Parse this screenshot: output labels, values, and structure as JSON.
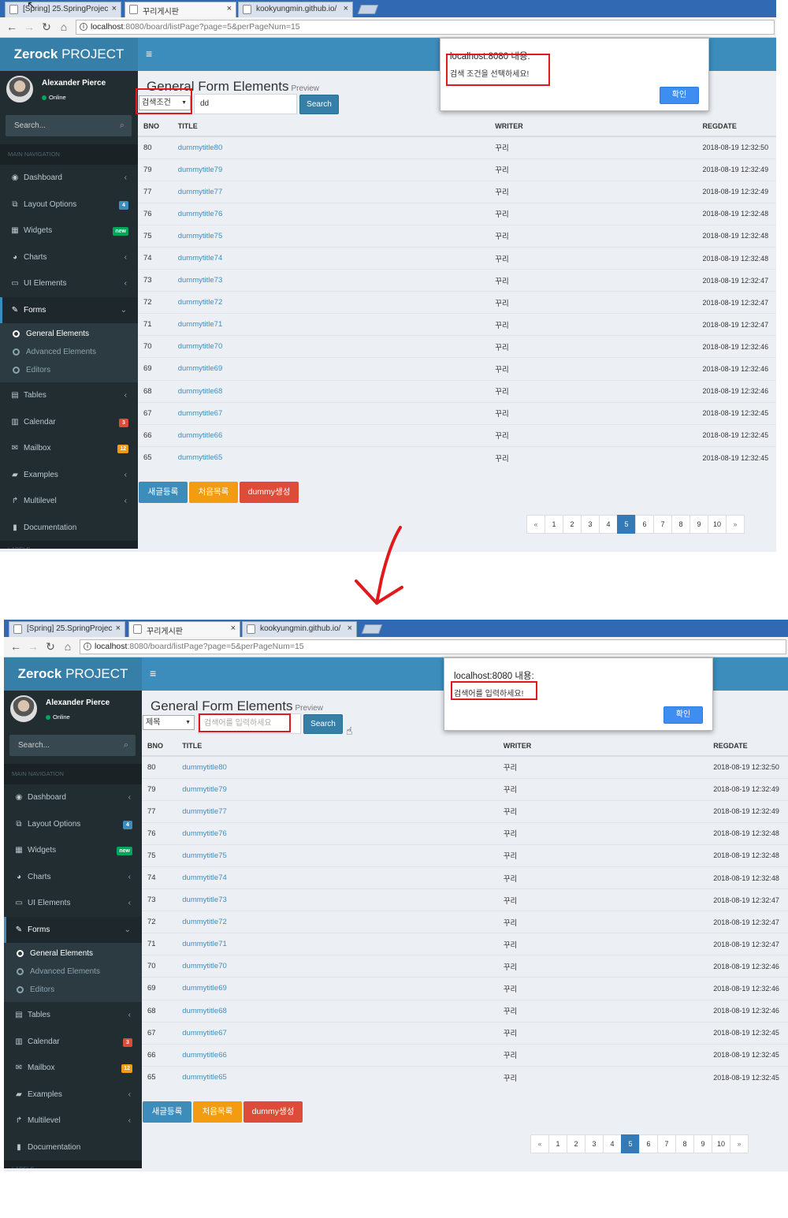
{
  "browser": {
    "tabs": [
      {
        "label": "[Spring] 25.SpringProjec",
        "close": "×"
      },
      {
        "label": "꾸리게시판",
        "close": "×"
      },
      {
        "label": "kookyungmin.github.io/",
        "close": "×"
      }
    ],
    "url_host": "localhost",
    "url_path": ":8080/board/listPage?page=5&perPageNum=15"
  },
  "app": {
    "logo_bold": "Zerock",
    "logo_light": " PROJECT",
    "menu_toggle": "≡"
  },
  "sidebar": {
    "user_name": "Alexander Pierce",
    "user_status": "Online",
    "search_placeholder": "Search...",
    "section_header": "MAIN NAVIGATION",
    "footer_header": "LABELS",
    "items": [
      {
        "label": "Dashboard",
        "icon": "dashboard-icon",
        "glyph": "◉",
        "chevron": "‹"
      },
      {
        "label": "Layout Options",
        "icon": "files-icon",
        "glyph": "⧉",
        "badge": "4",
        "badge_color": "#3c8dbc"
      },
      {
        "label": "Widgets",
        "icon": "th-icon",
        "glyph": "▦",
        "badge": "new",
        "badge_color": "#00a65a"
      },
      {
        "label": "Charts",
        "icon": "pie-chart-icon",
        "glyph": "◕",
        "chevron": "‹"
      },
      {
        "label": "UI Elements",
        "icon": "laptop-icon",
        "glyph": "▭",
        "chevron": "‹"
      },
      {
        "label": "Forms",
        "icon": "edit-icon",
        "glyph": "✎",
        "chevron": "⌄"
      },
      {
        "label": "Tables",
        "icon": "table-icon",
        "glyph": "▤",
        "chevron": "‹"
      },
      {
        "label": "Calendar",
        "icon": "calendar-icon",
        "glyph": "▥",
        "badge": "3",
        "badge_color": "#dd4b39"
      },
      {
        "label": "Mailbox",
        "icon": "envelope-icon",
        "glyph": "✉",
        "badge": "12",
        "badge_color": "#f39c12"
      },
      {
        "label": "Examples",
        "icon": "folder-icon",
        "glyph": "▰",
        "chevron": "‹"
      },
      {
        "label": "Multilevel",
        "icon": "share-icon",
        "glyph": "↱",
        "chevron": "‹"
      },
      {
        "label": "Documentation",
        "icon": "book-icon",
        "glyph": "▮"
      }
    ],
    "forms_sub": [
      "General Elements",
      "Advanced Elements",
      "Editors"
    ]
  },
  "page": {
    "title": "General Form Elements",
    "subtitle": "Preview",
    "search_button": "Search",
    "columns": [
      "BNO",
      "TITLE",
      "WRITER",
      "REGDATE"
    ],
    "rows": [
      [
        "80",
        "dummytitle80",
        "꾸리",
        "2018-08-19 12:32:50"
      ],
      [
        "79",
        "dummytitle79",
        "꾸리",
        "2018-08-19 12:32:49"
      ],
      [
        "77",
        "dummytitle77",
        "꾸리",
        "2018-08-19 12:32:49"
      ],
      [
        "76",
        "dummytitle76",
        "꾸리",
        "2018-08-19 12:32:48"
      ],
      [
        "75",
        "dummytitle75",
        "꾸리",
        "2018-08-19 12:32:48"
      ],
      [
        "74",
        "dummytitle74",
        "꾸리",
        "2018-08-19 12:32:48"
      ],
      [
        "73",
        "dummytitle73",
        "꾸리",
        "2018-08-19 12:32:47"
      ],
      [
        "72",
        "dummytitle72",
        "꾸리",
        "2018-08-19 12:32:47"
      ],
      [
        "71",
        "dummytitle71",
        "꾸리",
        "2018-08-19 12:32:47"
      ],
      [
        "70",
        "dummytitle70",
        "꾸리",
        "2018-08-19 12:32:46"
      ],
      [
        "69",
        "dummytitle69",
        "꾸리",
        "2018-08-19 12:32:46"
      ],
      [
        "68",
        "dummytitle68",
        "꾸리",
        "2018-08-19 12:32:46"
      ],
      [
        "67",
        "dummytitle67",
        "꾸리",
        "2018-08-19 12:32:45"
      ],
      [
        "66",
        "dummytitle66",
        "꾸리",
        "2018-08-19 12:32:45"
      ],
      [
        "65",
        "dummytitle65",
        "꾸리",
        "2018-08-19 12:32:45"
      ]
    ],
    "action_buttons": [
      {
        "label": "새글등록",
        "color": "#3c8dbc"
      },
      {
        "label": "처음목록",
        "color": "#f39c12"
      },
      {
        "label": "dummy생성",
        "color": "#dd4b39"
      }
    ],
    "pagination": {
      "prev": "«",
      "pages": [
        "1",
        "2",
        "3",
        "4",
        "5",
        "6",
        "7",
        "8",
        "9",
        "10"
      ],
      "current": "5",
      "next": "»"
    }
  },
  "shots": [
    {
      "select_value": "검색조건",
      "keyword_value": "dd",
      "keyword_placeholder": "",
      "dialog_title": "localhost:8080 내용:",
      "dialog_message": "검색 조건을 선택하세요!",
      "dialog_ok": "확인"
    },
    {
      "select_value": "제목",
      "keyword_value": "",
      "keyword_placeholder": "검색어를 입력하세요",
      "dialog_title": "localhost:8080 내용:",
      "dialog_message": "검색어를 입력하세요!",
      "dialog_ok": "확인"
    }
  ],
  "colors": {
    "annotation_red": "#e0191d",
    "link_blue": "#3c8dbc"
  }
}
